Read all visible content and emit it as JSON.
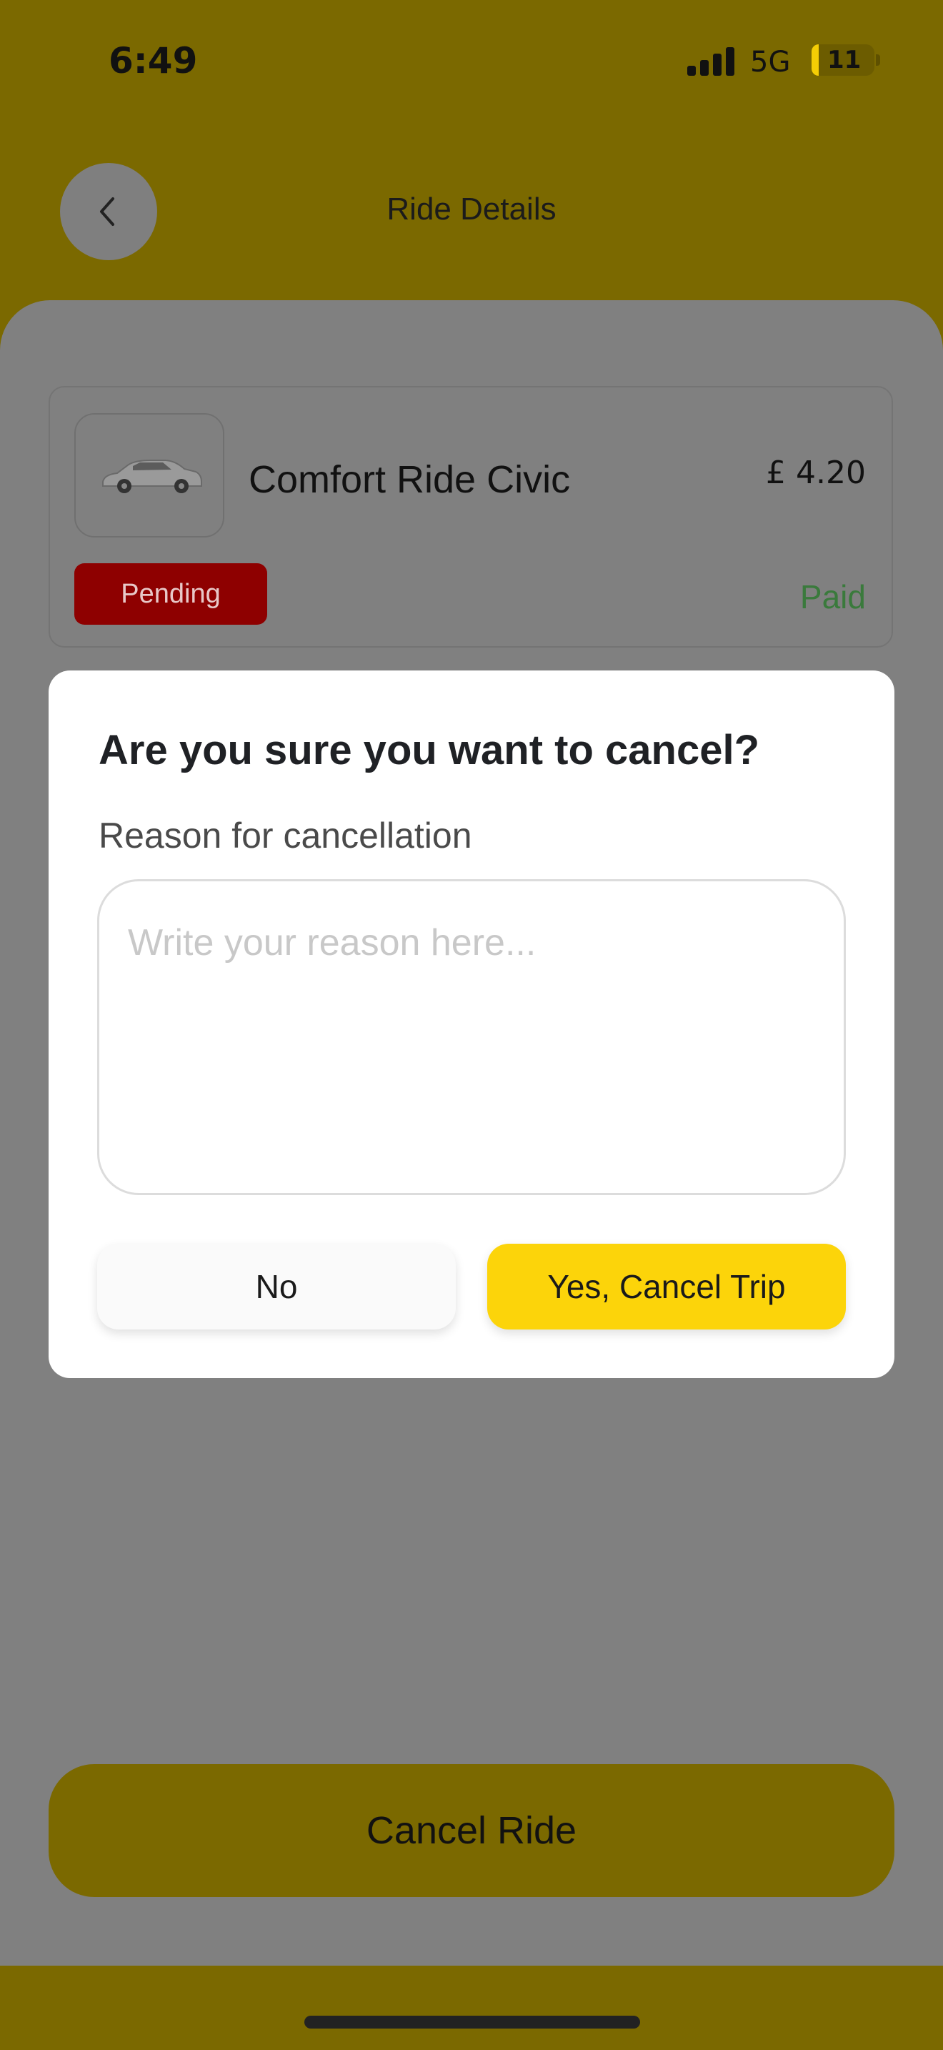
{
  "status_bar": {
    "time": "6:49",
    "network": "5G",
    "battery_level": "11",
    "battery_fraction": 0.11
  },
  "header": {
    "back_icon": "chevron-left-icon",
    "title": "Ride Details"
  },
  "ride": {
    "name": "Comfort Ride Civic",
    "price": "£ 4.20",
    "status": "Pending",
    "payment_status": "Paid",
    "car_icon": "car-image"
  },
  "dialog": {
    "title": "Are you sure you want to cancel?",
    "reason_label": "Reason for cancellation",
    "reason_placeholder": "Write your reason here...",
    "reason_value": "",
    "no_label": "No",
    "confirm_label": "Yes, Cancel Trip"
  },
  "footer": {
    "cancel_label": "Cancel Ride"
  },
  "colors": {
    "accent": "#FCD40A",
    "pending": "#8E0000",
    "paid": "#3A7A3C",
    "overlay_header": "#7B6900",
    "overlay_sheet": "#808080"
  }
}
